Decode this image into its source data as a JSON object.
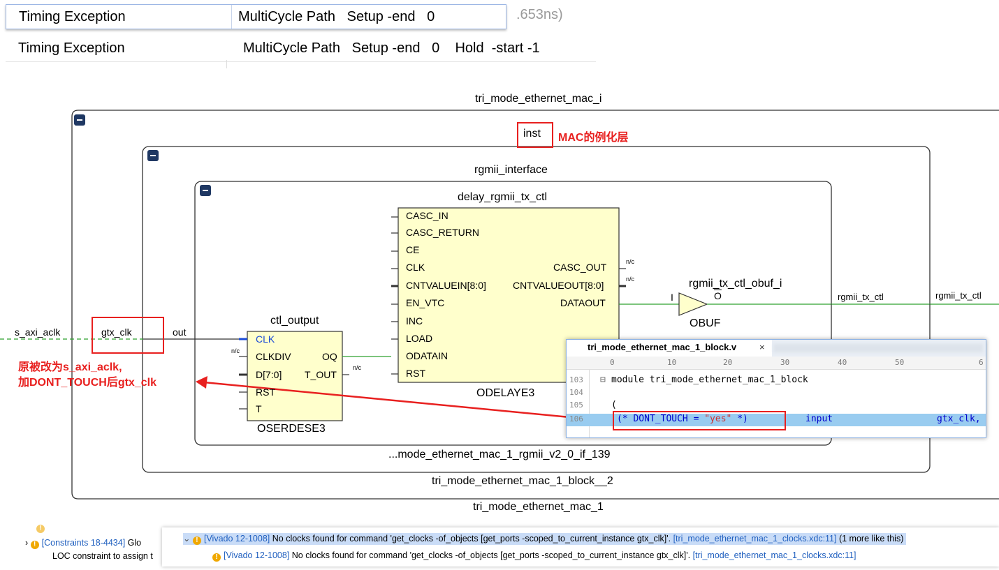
{
  "properties": {
    "row1": {
      "key": "Timing Exception",
      "value": "MultiCycle Path   Setup -end   0",
      "behind_text": ".653ns)"
    },
    "row2": {
      "key": "Timing Exception",
      "value": "MultiCycle Path   Setup -end   0    Hold  -start -1"
    }
  },
  "schematic": {
    "outer": "tri_mode_ethernet_mac_i",
    "inst_label": "inst",
    "inst_note": "MAC的例化层",
    "rgmii_interface": "rgmii_interface",
    "delay_block_title": "delay_rgmii_tx_ctl",
    "odelay_ports_left": [
      "CASC_IN",
      "CASC_RETURN",
      "CE",
      "CLK",
      "CNTVALUEIN[8:0]",
      "EN_VTC",
      "INC",
      "LOAD",
      "ODATAIN",
      "RST"
    ],
    "odelay_ports_right": [
      "CASC_OUT",
      "CNTVALUEOUT[8:0]",
      "DATAOUT"
    ],
    "odelay_type": "ODELAYE3",
    "oserdes_title": "ctl_output",
    "oserdes_ports_left": [
      "CLK",
      "CLKDIV",
      "D[7:0]",
      "RST",
      "T"
    ],
    "oserdes_ports_right": [
      "OQ",
      "T_OUT"
    ],
    "oserdes_type": "OSERDESE3",
    "obuf_title": "rgmii_tx_ctl_obuf_i",
    "obuf_in": "I",
    "obuf_out": "O",
    "obuf_type": "OBUF",
    "net_rgmii1": "rgmii_tx_ctl",
    "net_rgmii2": "rgmii_tx_ctl",
    "nc": "n/c",
    "s_axi_aclk": "s_axi_aclk",
    "gtx_clk": "gtx_clk",
    "out": "out",
    "inner_footer": "...mode_ethernet_mac_1_rgmii_v2_0_if_139",
    "block2_footer": "tri_mode_ethernet_mac_1_block__2",
    "outer_footer": "tri_mode_ethernet_mac_1",
    "note_line1": "原被改为s_axi_aclk,",
    "note_line2": "加DONT_TOUCH后gtx_clk"
  },
  "code_window": {
    "tab_name": "tri_mode_ethernet_mac_1_block.v",
    "tab_close": "×",
    "ruler": [
      "0",
      "10",
      "20",
      "30",
      "40",
      "50",
      "6"
    ],
    "lines": [
      {
        "num": "103",
        "text": "module tri_mode_ethernet_mac_1_block"
      },
      {
        "num": "104",
        "text": ""
      },
      {
        "num": "105",
        "text": "("
      },
      {
        "num": "106",
        "attr": "(* DONT_TOUCH = ",
        "str": "\"yes\"",
        "attr_end": " *)",
        "port_kw": "input",
        "port": "gtx_clk,"
      }
    ]
  },
  "messages": {
    "left1_id": "[Constraints 18-4434]",
    "left1_tail": " Glo",
    "left2": "LOC constraint to assign t",
    "m1_id": "[Vivado 12-1008]",
    "m1_text": " No clocks found for command 'get_clocks -of_objects [get_ports -scoped_to_current_instance gtx_clk]'. ",
    "m1_file": "[tri_mode_ethernet_mac_1_clocks.xdc:11]",
    "m1_more": " (1 more like this)",
    "m2_id": "[Vivado 12-1008]",
    "m2_text": " No clocks found for command 'get_clocks -of_objects [get_ports -scoped_to_current_instance gtx_clk]'. ",
    "m2_file": "[tri_mode_ethernet_mac_1_clocks.xdc:11]"
  },
  "colors": {
    "accent_red": "#e8201f",
    "block_fill": "#ffffcc",
    "net_green": "#2da02d",
    "link": "#1f5fbf"
  }
}
